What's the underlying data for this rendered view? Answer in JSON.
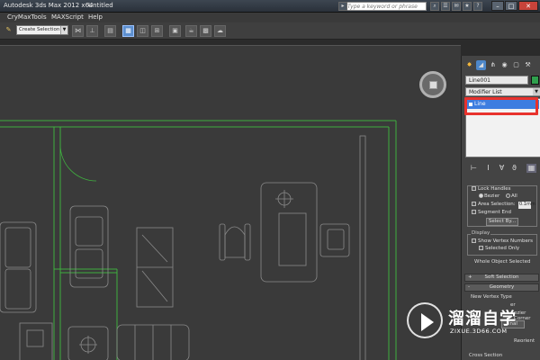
{
  "titlebar": {
    "app_title": "Autodesk 3ds Max  2012 x64",
    "doc_title": "Untitled",
    "search_placeholder": "Type a keyword or phrase"
  },
  "menubar": {
    "items": [
      "CryMaxTools",
      "MAXScript",
      "Help"
    ]
  },
  "toolbar": {
    "selection_set": "Create Selection Se"
  },
  "panel": {
    "object_name": "Line001",
    "object_color": "#2fa04d",
    "modifier_list": "Modifier List",
    "stack_items": [
      "Line"
    ],
    "selection": {
      "lock_handles": "Lock Handles",
      "bezier": "Bezier",
      "all": "All",
      "area_selection": "Area Selection:",
      "area_value": "0.1mm",
      "segment_end": "Segment End",
      "select_by": "Select By...",
      "display_title": "Display",
      "show_vertex_numbers": "Show Vertex Numbers",
      "selected_only": "Selected Only",
      "status": "Whole Object Selected"
    },
    "rollouts": {
      "soft_selection": "Soft Selection",
      "geometry": "Geometry",
      "new_vertex_type": "New Vertex Type",
      "cross_section": "Cross Section",
      "partial_1": "er",
      "partial_2": "ezier Corner",
      "partial_3": "inal",
      "partial_4": "Reorient"
    }
  },
  "watermark": {
    "brand": "溜溜自学",
    "url": "ZIXUE.3D66.COM"
  },
  "accent_colors": {
    "selection_highlight": "#3d7de0",
    "annotation_box": "#e8322d",
    "drawing_green": "#3fae3f"
  }
}
